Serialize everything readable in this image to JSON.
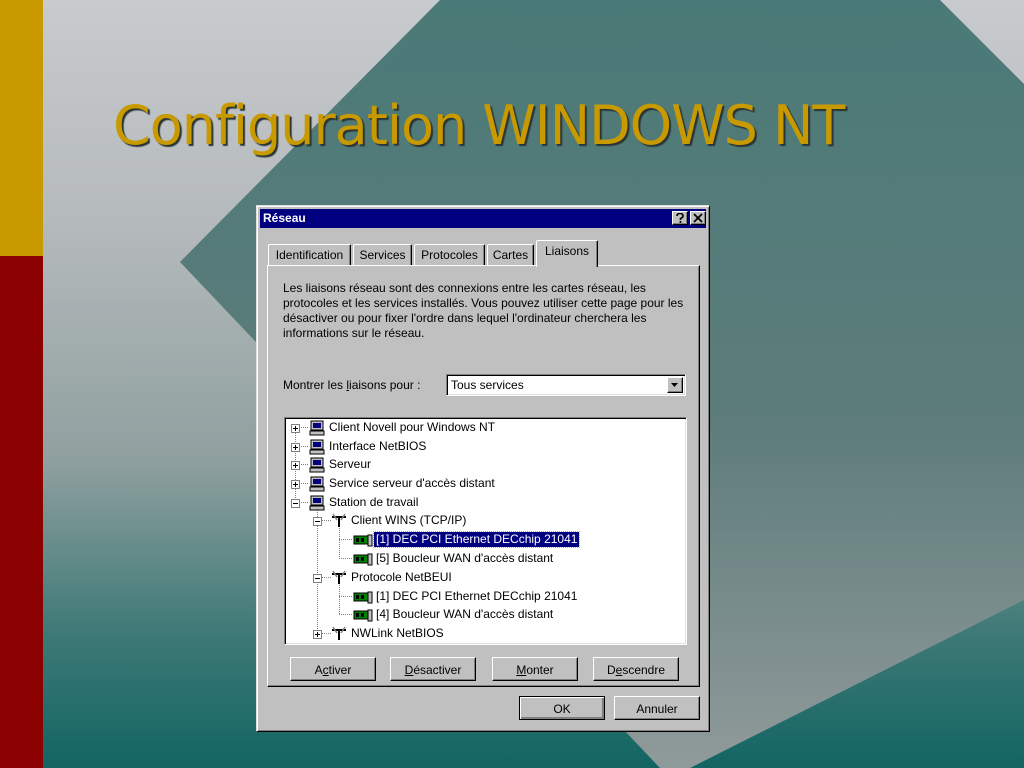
{
  "slide": {
    "title": "Configuration WINDOWS NT"
  },
  "dialog": {
    "title": "Réseau",
    "help_icon": "question-mark-icon",
    "close_icon": "close-icon",
    "tabs": [
      {
        "label": "Identification"
      },
      {
        "label": "Services"
      },
      {
        "label": "Protocoles"
      },
      {
        "label": "Cartes"
      },
      {
        "label": "Liaisons",
        "active": true
      }
    ],
    "description": "Les liaisons réseau sont des connexions entre les cartes réseau, les protocoles et les services installés.  Vous pouvez utiliser cette page pour les désactiver ou pour fixer l'ordre dans lequel l'ordinateur cherchera les informations sur le réseau.",
    "show_label": {
      "pre": "Montrer les ",
      "accel": "l",
      "post": "iaisons pour :"
    },
    "show_select": {
      "value": "Tous services"
    },
    "tree": [
      {
        "label": "Client Novell pour Windows NT",
        "icon": "computer-icon",
        "state": "collapsed"
      },
      {
        "label": "Interface NetBIOS",
        "icon": "computer-icon",
        "state": "collapsed"
      },
      {
        "label": "Serveur",
        "icon": "computer-icon",
        "state": "collapsed"
      },
      {
        "label": "Service serveur d'accès distant",
        "icon": "computer-icon",
        "state": "collapsed"
      },
      {
        "label": "Station de travail",
        "icon": "computer-icon",
        "state": "expanded"
      },
      {
        "label": "Client WINS (TCP/IP)",
        "icon": "protocol-icon",
        "state": "expanded"
      },
      {
        "label": "[1] DEC PCI Ethernet DECchip 21041",
        "icon": "network-card-icon",
        "state": "leaf",
        "selected": true
      },
      {
        "label": "[5] Boucleur WAN d'accès distant",
        "icon": "network-card-icon",
        "state": "leaf"
      },
      {
        "label": "Protocole NetBEUI",
        "icon": "protocol-icon",
        "state": "expanded"
      },
      {
        "label": "[1] DEC PCI Ethernet DECchip 21041",
        "icon": "network-card-icon",
        "state": "leaf"
      },
      {
        "label": "[4] Boucleur WAN d'accès distant",
        "icon": "network-card-icon",
        "state": "leaf"
      },
      {
        "label": "NWLink NetBIOS",
        "icon": "protocol-icon",
        "state": "collapsed"
      }
    ],
    "action_buttons": {
      "activate": {
        "pre": "A",
        "accel": "c",
        "post": "tiver"
      },
      "deactivate": {
        "pre": "",
        "accel": "D",
        "post": "ésactiver"
      },
      "move_up": {
        "pre": "",
        "accel": "M",
        "post": "onter"
      },
      "move_down": {
        "pre": "D",
        "accel": "e",
        "post": "scendre"
      }
    },
    "ok_label": "OK",
    "cancel_label": "Annuler"
  }
}
